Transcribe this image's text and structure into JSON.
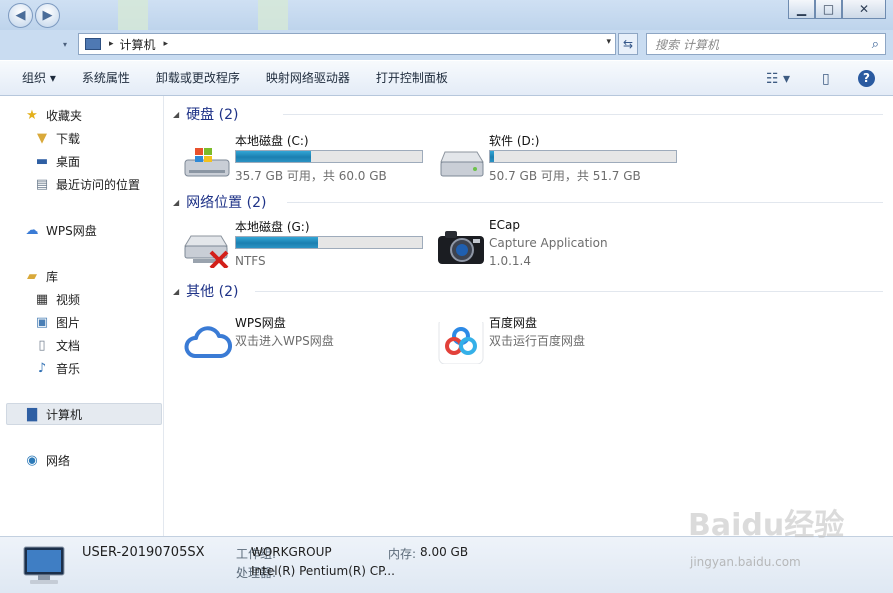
{
  "window": {
    "minimize_glyph": "▁",
    "maximize_glyph": "□",
    "close_glyph": "✕"
  },
  "address": {
    "path": "计算机",
    "sep": "▸",
    "drop": "▾"
  },
  "search": {
    "placeholder": "搜索 计算机"
  },
  "toolbar": {
    "organize": "组织 ▾",
    "items": [
      "系统属性",
      "卸载或更改程序",
      "映射网络驱动器",
      "打开控制面板"
    ]
  },
  "sidebar": {
    "favorites": "收藏夹",
    "downloads": "下载",
    "desktop": "桌面",
    "recent": "最近访问的位置",
    "wps": "WPS网盘",
    "libraries": "库",
    "videos": "视频",
    "pictures": "图片",
    "documents": "文档",
    "music": "音乐",
    "computer": "计算机",
    "network": "网络"
  },
  "groups": {
    "hdd": "硬盘 (2)",
    "netloc": "网络位置 (2)",
    "other": "其他 (2)"
  },
  "drives": [
    {
      "name": "本地磁盘 (C:)",
      "info": "35.7 GB 可用，共 60.0 GB",
      "used_fraction": 0.405
    },
    {
      "name": "软件 (D:)",
      "info": "50.7 GB 可用，共 51.7 GB",
      "used_fraction": 0.019
    }
  ],
  "network_items": [
    {
      "name": "本地磁盘 (G:)",
      "info": "NTFS",
      "used_fraction": 0.44
    },
    {
      "name": "ECap",
      "line1": "Capture Application",
      "line2": "1.0.1.4"
    }
  ],
  "other_items": [
    {
      "name": "WPS网盘",
      "desc": "双击进入WPS网盘"
    },
    {
      "name": "百度网盘",
      "desc": "双击运行百度网盘"
    }
  ],
  "status": {
    "computer_name": "USER-20190705SX",
    "workgroup_label": "工作组:",
    "workgroup": "WORKGROUP",
    "memory_label": "内存:",
    "memory": "8.00 GB",
    "cpu_label": "处理器:",
    "cpu": "Intel(R) Pentium(R) CP..."
  },
  "watermark": {
    "main": "Baidu经验",
    "sub": "jingyan.baidu.com"
  },
  "colors": {
    "accent": "#1e3287",
    "bar": "#1b7fb0",
    "titlebar": "#c9dcf1"
  }
}
